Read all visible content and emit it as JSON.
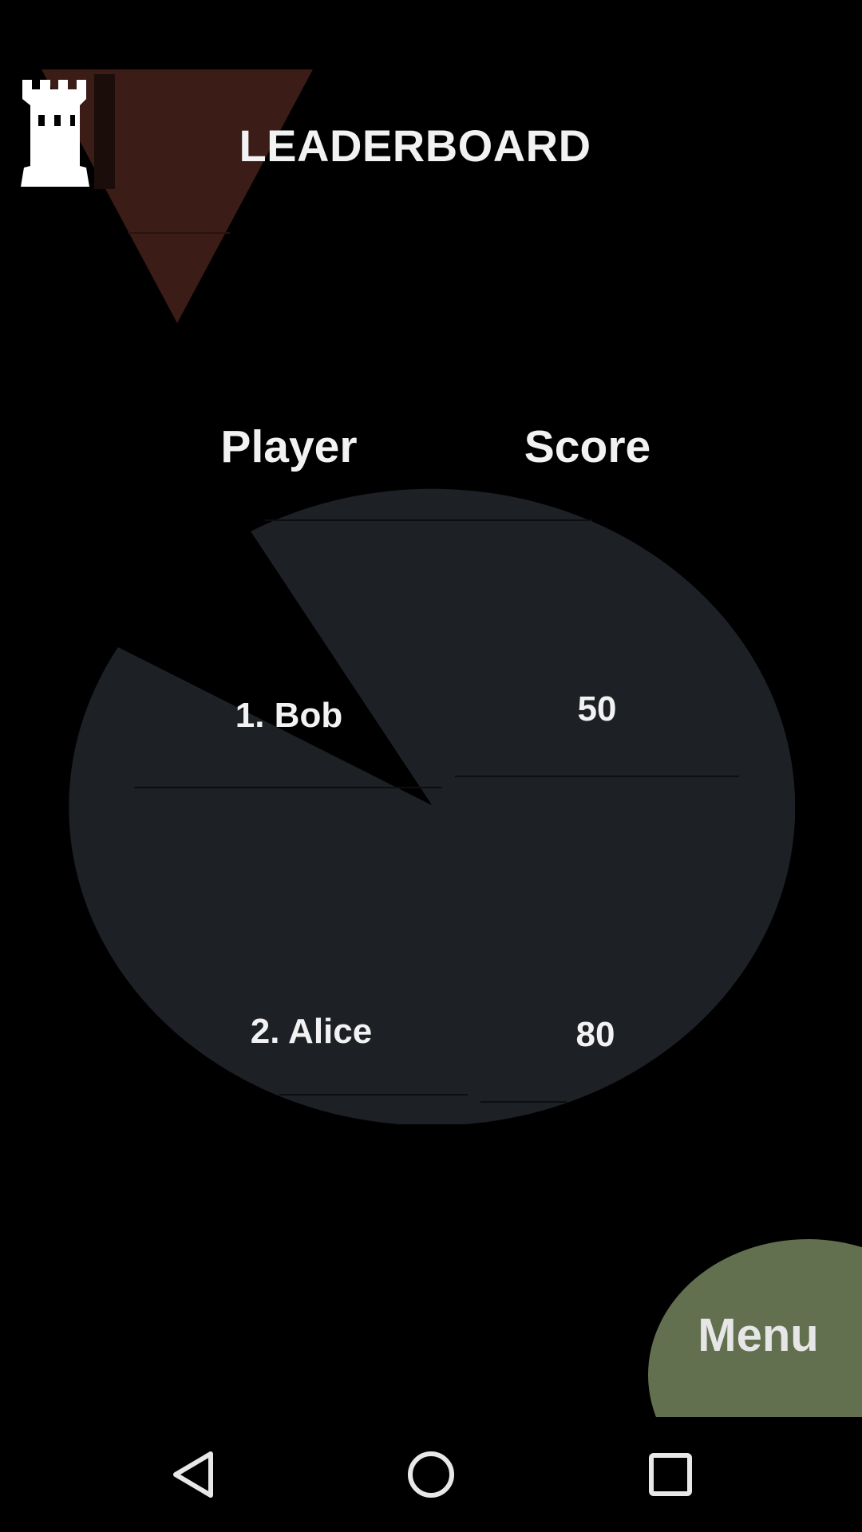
{
  "header": {
    "title": "LEADERBOARD",
    "logo_icon": "rook-tower-icon"
  },
  "table": {
    "columns": [
      "Player",
      "Score"
    ],
    "rows": [
      {
        "player": "1. Bob",
        "score": "50"
      },
      {
        "player": "2. Alice",
        "score": "80"
      }
    ]
  },
  "menu": {
    "label": "Menu"
  },
  "navbar": {
    "icons": [
      "back-icon",
      "home-icon",
      "recents-icon"
    ]
  },
  "colors": {
    "background": "#000000",
    "triangle": "#3b1c16",
    "pie": "#1d2024",
    "menu_blob": "#627050",
    "text": "#f2f2f2"
  }
}
